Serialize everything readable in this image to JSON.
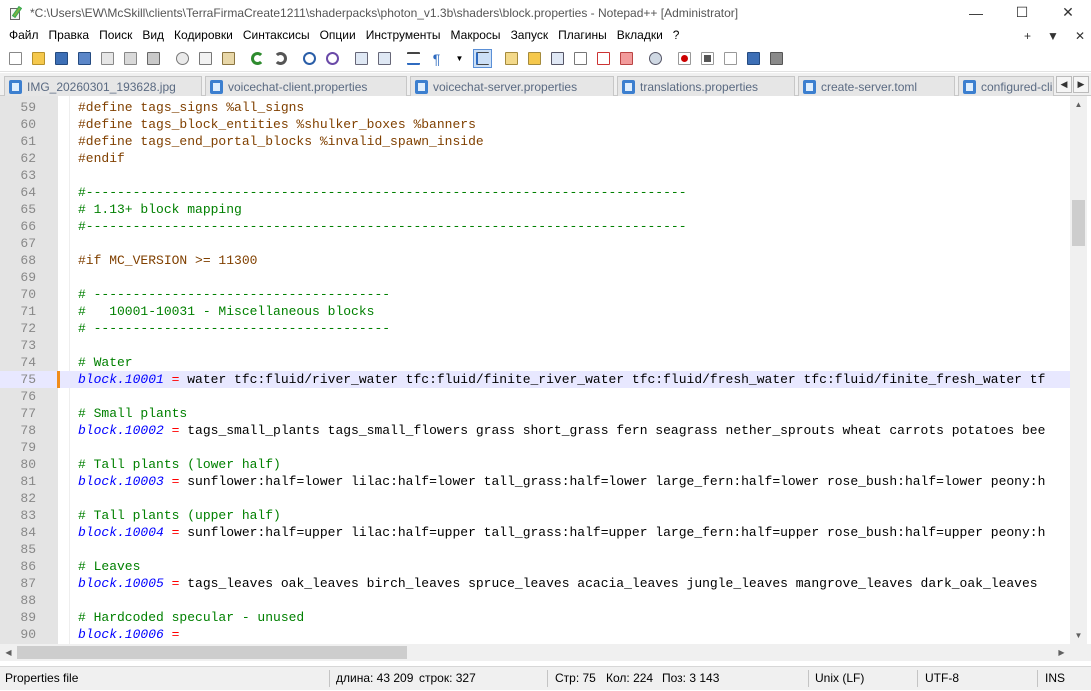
{
  "window": {
    "title": "*C:\\Users\\EW\\McSkill\\clients\\TerraFirmaCreate1211\\shaderpacks\\photon_v1.3b\\shaders\\block.properties - Notepad++ [Administrator]",
    "minimize": "—",
    "maximize": "☐",
    "close": "✕"
  },
  "menu": {
    "items": [
      "Файл",
      "Правка",
      "Поиск",
      "Вид",
      "Кодировки",
      "Синтаксисы",
      "Опции",
      "Инструменты",
      "Макросы",
      "Запуск",
      "Плагины",
      "Вкладки",
      "?"
    ],
    "right": [
      "+",
      "▼",
      "✕"
    ]
  },
  "tabs": [
    {
      "label": "IMG_20260301_193628.jpg"
    },
    {
      "label": "voicechat-client.properties"
    },
    {
      "label": "voicechat-server.properties"
    },
    {
      "label": "translations.properties"
    },
    {
      "label": "create-server.toml"
    },
    {
      "label": "configured-cli"
    }
  ],
  "tab_scroll": {
    "left": "◀",
    "right": "▶"
  },
  "editor": {
    "lines": [
      {
        "n": "59",
        "parts": [
          {
            "t": "#define tags_signs %all_signs",
            "c": "pre"
          }
        ]
      },
      {
        "n": "60",
        "parts": [
          {
            "t": "#define tags_block_entities %shulker_boxes %banners",
            "c": "pre"
          }
        ]
      },
      {
        "n": "61",
        "parts": [
          {
            "t": "#define tags_end_portal_blocks %invalid_spawn_inside",
            "c": "pre"
          }
        ]
      },
      {
        "n": "62",
        "parts": [
          {
            "t": "#endif",
            "c": "pre"
          }
        ]
      },
      {
        "n": "63",
        "parts": []
      },
      {
        "n": "64",
        "parts": [
          {
            "t": "#-----------------------------------------------------------------------------",
            "c": "cmt"
          }
        ]
      },
      {
        "n": "65",
        "parts": [
          {
            "t": "# 1.13+ block mapping",
            "c": "cmt"
          }
        ]
      },
      {
        "n": "66",
        "parts": [
          {
            "t": "#-----------------------------------------------------------------------------",
            "c": "cmt"
          }
        ]
      },
      {
        "n": "67",
        "parts": []
      },
      {
        "n": "68",
        "parts": [
          {
            "t": "#if MC_VERSION >= 11300",
            "c": "pre"
          }
        ]
      },
      {
        "n": "69",
        "parts": []
      },
      {
        "n": "70",
        "parts": [
          {
            "t": "# --------------------------------------",
            "c": "cmt"
          }
        ]
      },
      {
        "n": "71",
        "parts": [
          {
            "t": "#   10001-10031 - Miscellaneous blocks",
            "c": "cmt"
          }
        ]
      },
      {
        "n": "72",
        "parts": [
          {
            "t": "# --------------------------------------",
            "c": "cmt"
          }
        ]
      },
      {
        "n": "73",
        "parts": []
      },
      {
        "n": "74",
        "parts": [
          {
            "t": "# Water",
            "c": "cmt"
          }
        ]
      },
      {
        "n": "75",
        "current": true,
        "changed": true,
        "parts": [
          {
            "t": "block.10001",
            "c": "key"
          },
          {
            "t": " = ",
            "c": "eq"
          },
          {
            "t": "water tfc:fluid/river_water tfc:fluid/finite_river_water tfc:fluid/fresh_water tfc:fluid/finite_fresh_water tf",
            "c": "val"
          }
        ]
      },
      {
        "n": "76",
        "parts": []
      },
      {
        "n": "77",
        "parts": [
          {
            "t": "# Small plants",
            "c": "cmt"
          }
        ]
      },
      {
        "n": "78",
        "parts": [
          {
            "t": "block.10002",
            "c": "key"
          },
          {
            "t": " = ",
            "c": "eq"
          },
          {
            "t": "tags_small_plants tags_small_flowers grass short_grass fern seagrass nether_sprouts wheat carrots potatoes bee",
            "c": "val"
          }
        ]
      },
      {
        "n": "79",
        "parts": []
      },
      {
        "n": "80",
        "parts": [
          {
            "t": "# Tall plants (lower half)",
            "c": "cmt"
          }
        ]
      },
      {
        "n": "81",
        "parts": [
          {
            "t": "block.10003",
            "c": "key"
          },
          {
            "t": " = ",
            "c": "eq"
          },
          {
            "t": "sunflower:half=lower lilac:half=lower tall_grass:half=lower large_fern:half=lower rose_bush:half=lower peony:h",
            "c": "val"
          }
        ]
      },
      {
        "n": "82",
        "parts": []
      },
      {
        "n": "83",
        "parts": [
          {
            "t": "# Tall plants (upper half)",
            "c": "cmt"
          }
        ]
      },
      {
        "n": "84",
        "parts": [
          {
            "t": "block.10004",
            "c": "key"
          },
          {
            "t": " = ",
            "c": "eq"
          },
          {
            "t": "sunflower:half=upper lilac:half=upper tall_grass:half=upper large_fern:half=upper rose_bush:half=upper peony:h",
            "c": "val"
          }
        ]
      },
      {
        "n": "85",
        "parts": []
      },
      {
        "n": "86",
        "parts": [
          {
            "t": "# Leaves",
            "c": "cmt"
          }
        ]
      },
      {
        "n": "87",
        "parts": [
          {
            "t": "block.10005",
            "c": "key"
          },
          {
            "t": " = ",
            "c": "eq"
          },
          {
            "t": "tags_leaves oak_leaves birch_leaves spruce_leaves acacia_leaves jungle_leaves mangrove_leaves dark_oak_leaves",
            "c": "val"
          }
        ]
      },
      {
        "n": "88",
        "parts": []
      },
      {
        "n": "89",
        "parts": [
          {
            "t": "# Hardcoded specular - unused",
            "c": "cmt"
          }
        ]
      },
      {
        "n": "90",
        "parts": [
          {
            "t": "block.10006",
            "c": "key"
          },
          {
            "t": " = ",
            "c": "eq"
          }
        ]
      }
    ]
  },
  "scrollbars": {
    "up": "▲",
    "down": "▼",
    "left": "◀",
    "right": "▶"
  },
  "status": {
    "file_type": "Properties file",
    "length": "длина: 43 209",
    "lines": "строк: 327",
    "line": "Стр: 75",
    "col": "Кол: 224",
    "pos": "Поз: 3 143",
    "eol": "Unix (LF)",
    "encoding": "UTF-8",
    "mode": "INS"
  },
  "colors": {
    "preprocessor": "#804000",
    "comment": "#008000",
    "key": "#0000ff",
    "operator": "#ff0000",
    "current_line": "#e8e8ff",
    "change_marker": "#f08c1a"
  }
}
